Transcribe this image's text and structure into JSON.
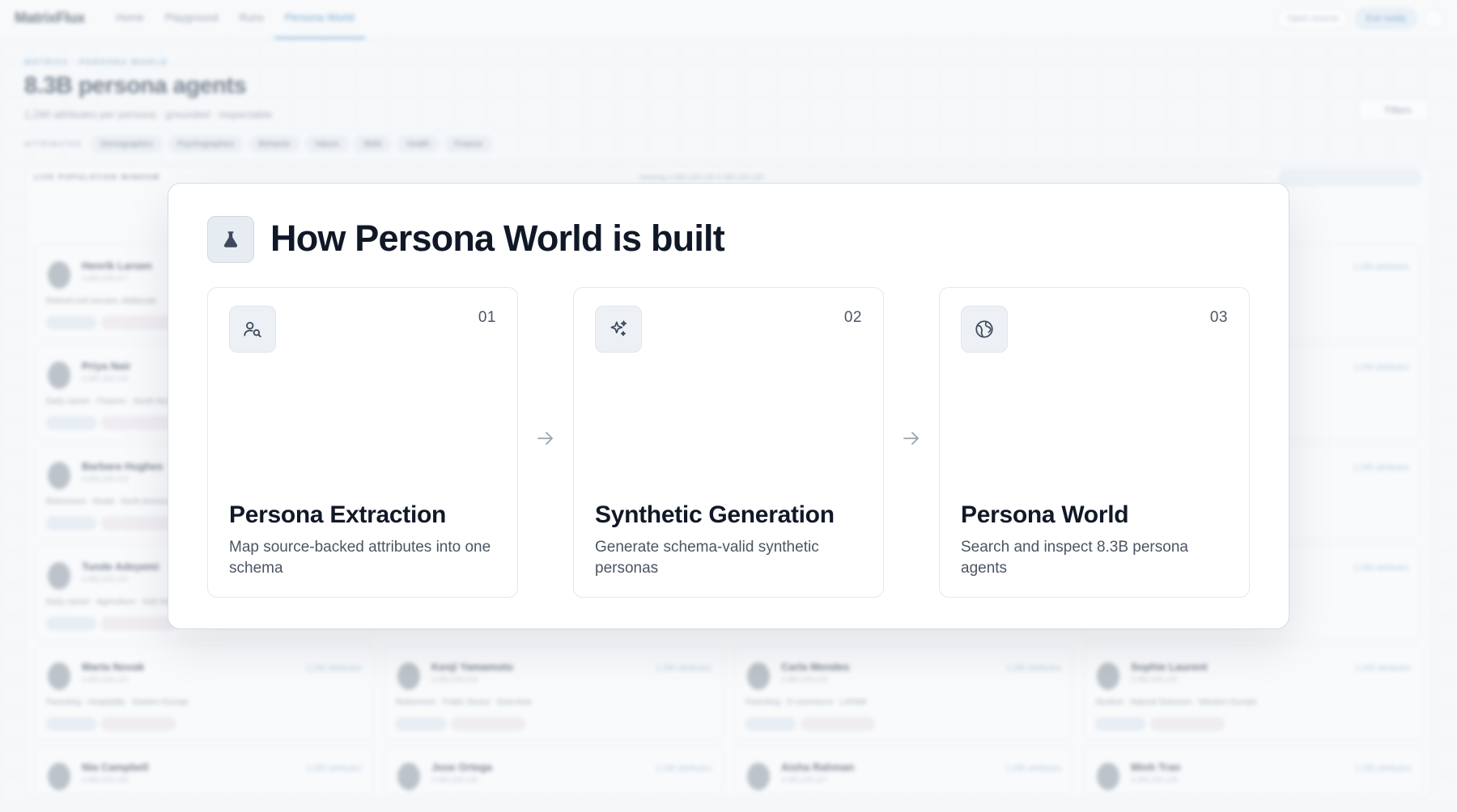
{
  "app": {
    "logo": "MatrixFlux",
    "nav": [
      "Home",
      "Playground",
      "Runs",
      "Persona World"
    ],
    "active_nav": "Persona World",
    "top_actions": [
      "Open source",
      "Eve ready"
    ]
  },
  "page": {
    "breadcrumb": "MATRIXX · PERSONA WORLD",
    "title": "8.3B persona agents",
    "subtitle": "1,290 attributes per persona · grounded · inspectable",
    "filters_label": "Filters",
    "attributes_label": "ATTRIBUTES",
    "attribute_chips": [
      "Demographics",
      "Psychographics",
      "Behavior",
      "Values",
      "Skills",
      "Health",
      "Finance"
    ],
    "live_label": "LIVE POPULATION WINDOW",
    "index_range": "showing 4,382,225,100-4,382,225,220",
    "personas": [
      {
        "name": "Henrik Larsen",
        "index": "4,382,225,117",
        "desc": "Retired civil servant, deliberate"
      },
      {
        "name": "Priya Nair",
        "index": "4,382,225,118",
        "desc": "Early career · Finance · South Asia"
      },
      {
        "name": "Barbara Hughes",
        "index": "4,382,225,119",
        "desc": "Retirement · Retail · North America"
      },
      {
        "name": "Tunde Adeyemi",
        "index": "4,382,225,120",
        "desc": "Early career · Agriculture · Sub-Saharan"
      },
      {
        "name": "Marta Novak",
        "index": "4,382,225,121",
        "desc": "Parenting · Hospitality · Eastern Europe"
      },
      {
        "name": "Kenji Yamamoto",
        "index": "4,382,225,122",
        "desc": "Retirement · Public Sector · East Asia"
      },
      {
        "name": "Carla Mendes",
        "index": "4,382,225,123",
        "desc": "Parenting · E-commerce · LATAM"
      },
      {
        "name": "Sophie Laurent",
        "index": "4,382,225,124",
        "desc": "Student · Natural Sciences · Western Europe"
      },
      {
        "name": "Nia Campbell",
        "index": "4,382,225,125",
        "desc": ""
      },
      {
        "name": "Jose Ortega",
        "index": "4,382,225,126",
        "desc": ""
      },
      {
        "name": "Aisha Rahman",
        "index": "4,382,225,127",
        "desc": ""
      },
      {
        "name": "Minh Tran",
        "index": "4,382,225,128",
        "desc": ""
      }
    ],
    "attr_count": "1,290 attributes"
  },
  "modal": {
    "icon": "flask-icon",
    "title": "How Persona World is built",
    "steps": [
      {
        "num": "01",
        "icon": "user-search-icon",
        "title": "Persona Extraction",
        "desc": "Map source-backed attributes into one schema"
      },
      {
        "num": "02",
        "icon": "sparkles-icon",
        "title": "Synthetic Generation",
        "desc": "Generate schema-valid synthetic personas"
      },
      {
        "num": "03",
        "icon": "globe-icon",
        "title": "Persona World",
        "desc": "Search and inspect 8.3B persona agents"
      }
    ]
  }
}
